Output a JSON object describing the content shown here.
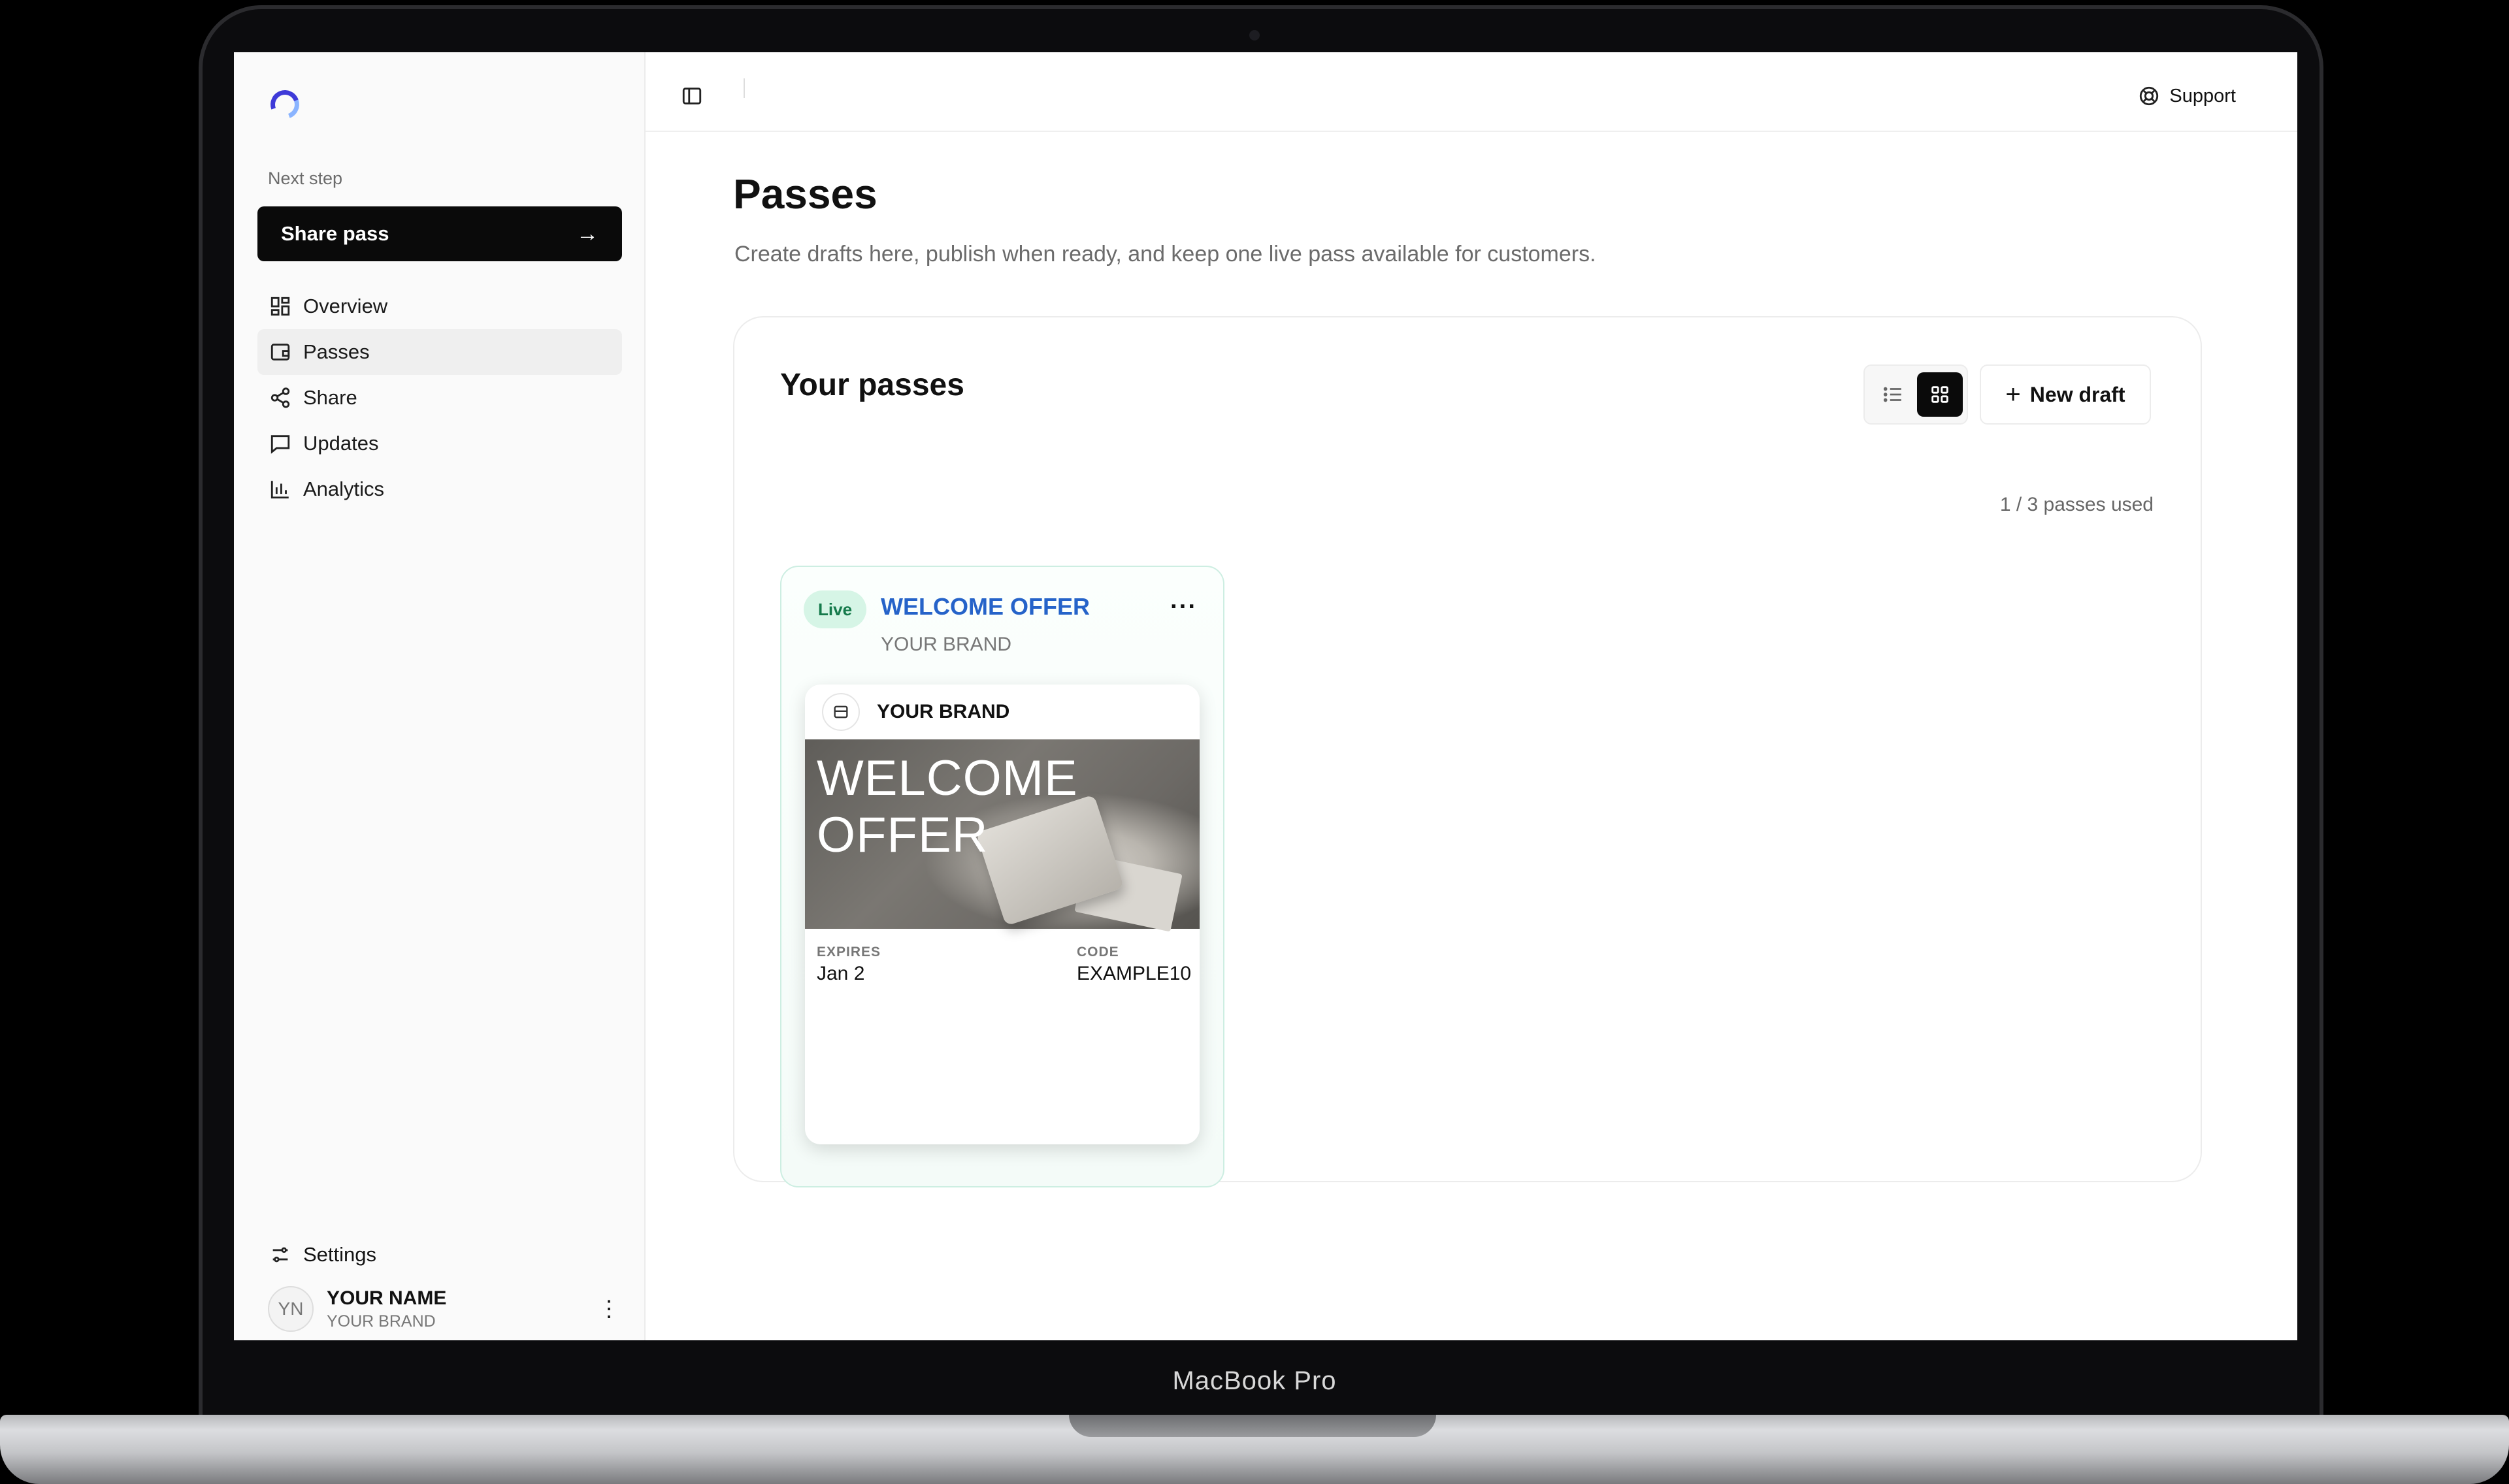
{
  "device": {
    "model_label": "MacBook Pro"
  },
  "sidebar": {
    "next_step_label": "Next step",
    "cta": {
      "label": "Share pass",
      "icon": "arrow-right-icon"
    },
    "items": [
      {
        "label": "Overview",
        "icon": "grid-layout-icon",
        "active": false
      },
      {
        "label": "Passes",
        "icon": "wallet-icon",
        "active": true
      },
      {
        "label": "Share",
        "icon": "share-nodes-icon",
        "active": false
      },
      {
        "label": "Updates",
        "icon": "message-icon",
        "active": false
      },
      {
        "label": "Analytics",
        "icon": "bar-chart-icon",
        "active": false
      }
    ],
    "settings_label": "Settings",
    "user": {
      "initials": "YN",
      "name": "YOUR NAME",
      "brand": "YOUR BRAND"
    }
  },
  "topbar": {
    "support_label": "Support"
  },
  "main": {
    "title": "Passes",
    "subtitle": "Create drafts here, publish when ready, and keep one live pass available for customers.",
    "card": {
      "title": "Your passes",
      "view_mode": "grid",
      "new_draft_label": "New draft",
      "usage": "1 / 3 passes used",
      "passes": [
        {
          "status": "Live",
          "title": "WELCOME OFFER",
          "brand": "YOUR BRAND",
          "preview": {
            "brand": "YOUR BRAND",
            "headline": "WELCOME OFFER",
            "expires_label": "EXPIRES",
            "expires_value": "Jan 2",
            "code_label": "CODE",
            "code_value": "EXAMPLE10"
          }
        }
      ]
    }
  },
  "colors": {
    "accent": "#3e3ad8",
    "live_badge_bg": "#d6f5e6",
    "live_badge_text": "#157a4b",
    "pass_title": "#2563c9",
    "primary_button": "#0a0a0a"
  }
}
